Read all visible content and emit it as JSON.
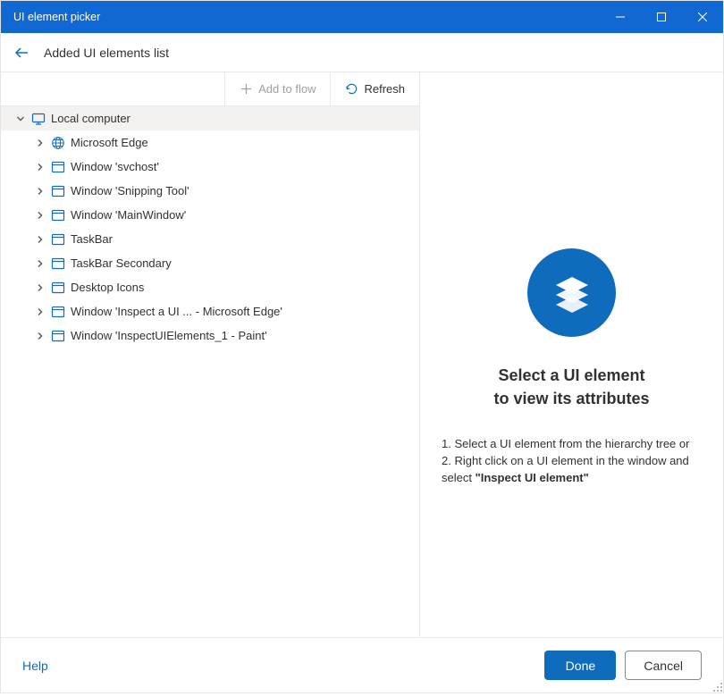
{
  "titlebar": {
    "title": "UI element picker"
  },
  "header": {
    "title": "Added UI elements list"
  },
  "toolbar": {
    "add_label": "Add to flow",
    "refresh_label": "Refresh"
  },
  "tree": {
    "root_label": "Local computer",
    "items": [
      {
        "label": "Microsoft Edge",
        "icon": "globe"
      },
      {
        "label": "Window 'svchost'",
        "icon": "window"
      },
      {
        "label": "Window 'Snipping Tool'",
        "icon": "window"
      },
      {
        "label": "Window 'MainWindow'",
        "icon": "window"
      },
      {
        "label": "TaskBar",
        "icon": "window"
      },
      {
        "label": "TaskBar Secondary",
        "icon": "window"
      },
      {
        "label": "Desktop Icons",
        "icon": "window"
      },
      {
        "label": "Window 'Inspect a UI  ...  - Microsoft Edge'",
        "icon": "window"
      },
      {
        "label": "Window 'InspectUIElements_1 - Paint'",
        "icon": "window"
      }
    ]
  },
  "empty": {
    "title_line1": "Select a UI element",
    "title_line2": "to view its attributes",
    "step1": "1. Select a UI element from the hierarchy tree or",
    "step2_pre": "2. Right click on a UI element in the window and select ",
    "step2_strong": "\"Inspect UI element\""
  },
  "footer": {
    "help_label": "Help",
    "done_label": "Done",
    "cancel_label": "Cancel"
  }
}
